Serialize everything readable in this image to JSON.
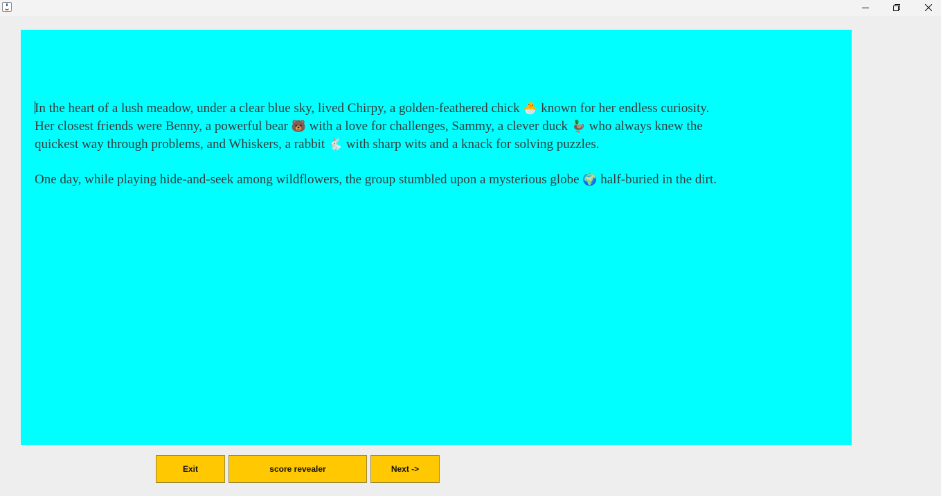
{
  "window": {
    "app_icon": "java-icon"
  },
  "story": {
    "background": "#00ffff",
    "p1": {
      "s1": "In the heart of a lush meadow, under a clear blue sky, lived Chirpy, a golden-feathered chick ",
      "e1": "🐣",
      "s2": " known for her endless curiosity. Her closest friends were Benny, a powerful bear ",
      "e2": "🐻",
      "s3": " with a love for challenges, Sammy, a clever duck ",
      "e3": "🦆",
      "s4": " who always knew the quickest way through problems, and Whiskers, a rabbit ",
      "e4": "🐇",
      "s5": " with sharp wits and a knack for solving puzzles."
    },
    "p2": {
      "s1": "One day, while playing hide-and-seek among wildflowers, the group stumbled upon a mysterious globe ",
      "e1": "🌍",
      "s2": " half-buried in the dirt."
    }
  },
  "buttons": {
    "exit": "Exit",
    "score": "score revealer",
    "next": "Next ->",
    "color": "#ffc800"
  }
}
